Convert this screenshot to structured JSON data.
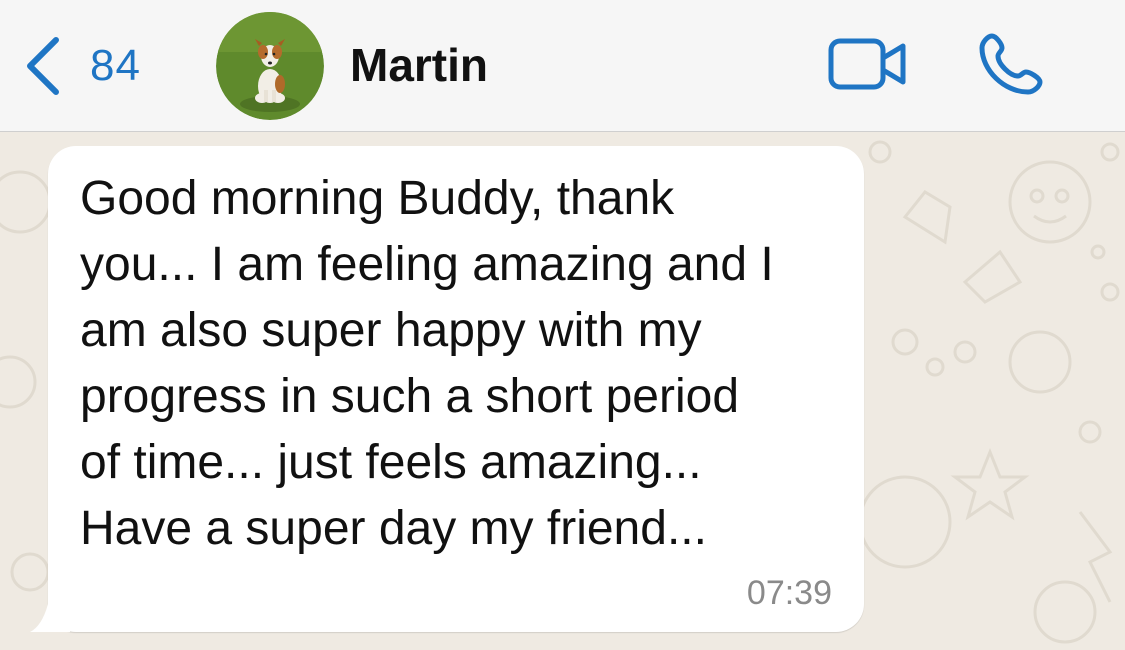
{
  "header": {
    "back_icon": "chevron-left-icon",
    "unread_count": "84",
    "contact_name": "Martin",
    "video_icon": "video-camera-icon",
    "call_icon": "phone-icon"
  },
  "colors": {
    "accent": "#1f75c4",
    "header_bg": "#f6f6f6",
    "chat_bg": "#efeae2",
    "bubble_bg": "#ffffff"
  },
  "message": {
    "text": "Good morning Buddy, thank\nyou... I am feeling amazing and I\nam also super happy with my\nprogress in such a short period\nof time... just feels amazing...\nHave a super day my friend...",
    "time": "07:39"
  }
}
